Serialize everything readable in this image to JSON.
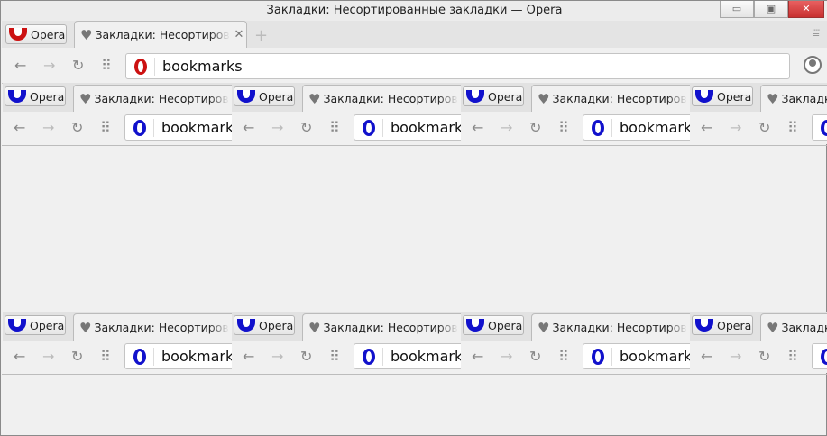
{
  "window": {
    "title": "Закладки: Несортированные закладки — Opera",
    "minimize": "▭",
    "maximize": "▣",
    "close": "✕"
  },
  "tabs": {
    "opera_label": "Opera",
    "tab_title": "Закладки: Несортированные закладки",
    "tab_close": "✕",
    "new_tab": "+",
    "menu": "⩸"
  },
  "toolbar": {
    "back": "←",
    "forward": "→",
    "reload": "↻",
    "speed_dial": "⠿",
    "url": "bookmarks"
  },
  "colors": {
    "opera_red": "#cc1111",
    "opera_blue": "#1111cc"
  }
}
